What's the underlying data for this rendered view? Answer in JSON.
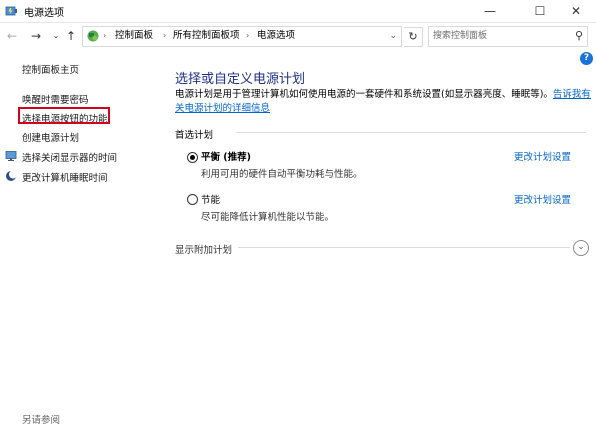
{
  "window": {
    "title": "电源选项",
    "controls": {
      "minimize": "—",
      "maximize": "☐",
      "close": "✕"
    }
  },
  "address_bar": {
    "nav": {
      "back": "←",
      "forward": "→",
      "history": "⌄",
      "up": "↑"
    },
    "crumbs": [
      "控制面板",
      "所有控制面板项",
      "电源选项"
    ],
    "crumb_sep": "›",
    "dropdown": "⌄",
    "refresh": "↻",
    "search_placeholder": "搜索控制面板",
    "search_icon": "⚲"
  },
  "help": "?",
  "sidebar": {
    "home": "控制面板主页",
    "items": [
      {
        "label": "唤醒时需要密码",
        "icon": null
      },
      {
        "label": "选择电源按钮的功能",
        "icon": null,
        "highlighted": true
      },
      {
        "label": "创建电源计划",
        "icon": null
      },
      {
        "label": "选择关闭显示器的时间",
        "icon": "monitor-icon"
      },
      {
        "label": "更改计算机睡眠时间",
        "icon": "moon-icon"
      }
    ],
    "see_also": "另请参阅"
  },
  "main": {
    "title": "选择或自定义电源计划",
    "description": "电源计划是用于管理计算机如何使用电源的一套硬件和系统设置(如显示器亮度、睡眠等)。",
    "description_link": "告诉我有关电源计划的详细信息",
    "section_label": "首选计划",
    "plans": [
      {
        "name": "平衡 (推荐)",
        "desc": "利用可用的硬件自动平衡功耗与性能。",
        "link": "更改计划设置",
        "selected": true
      },
      {
        "name": "节能",
        "desc": "尽可能降低计算机性能以节能。",
        "link": "更改计划设置",
        "selected": false
      }
    ],
    "show_additional": "显示附加计划",
    "expander_icon": "⌄"
  },
  "colors": {
    "accent": "#1e3287",
    "link": "#0066cc",
    "highlight_box": "#d0021b"
  }
}
